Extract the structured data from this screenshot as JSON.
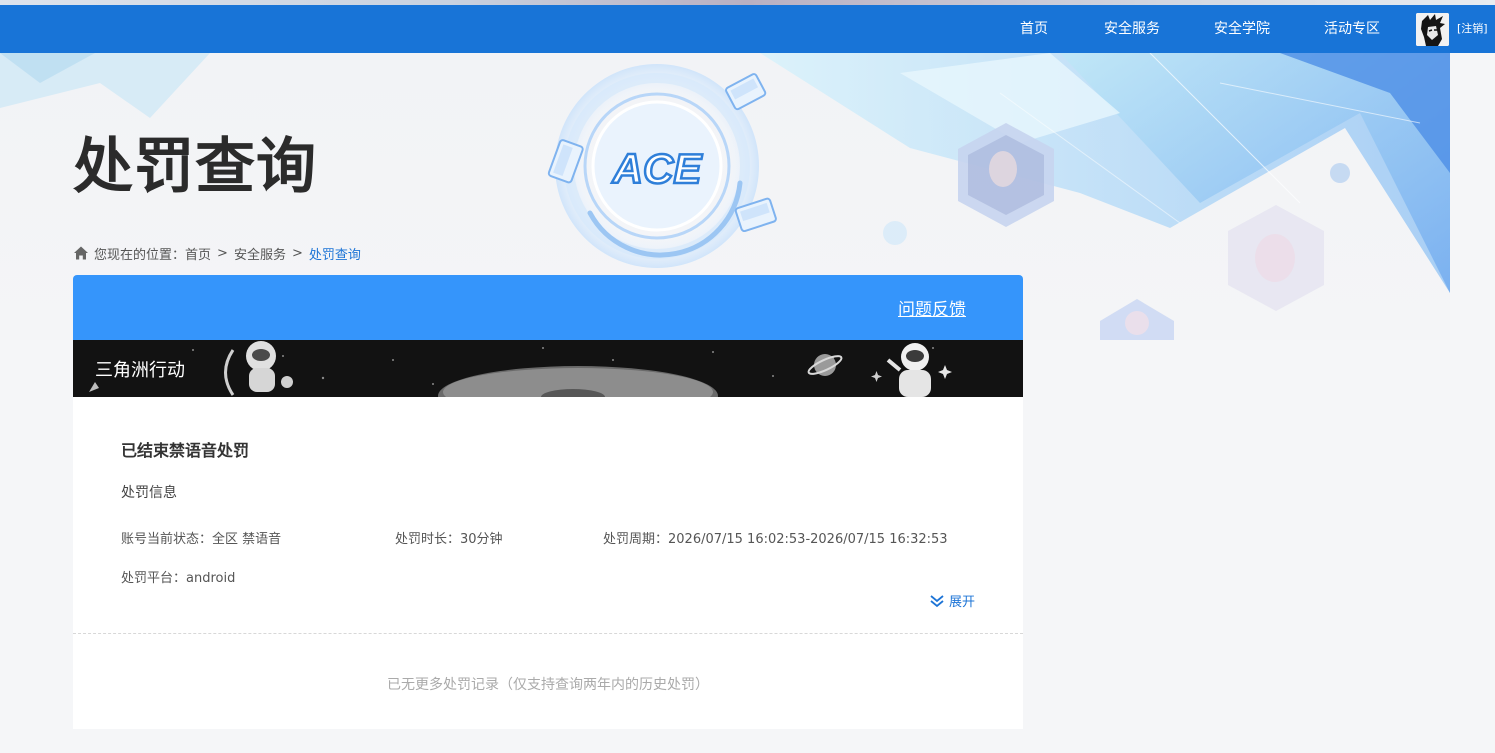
{
  "nav": {
    "items": [
      "首页",
      "安全服务",
      "安全学院",
      "活动专区"
    ],
    "logout": "[注销]"
  },
  "page": {
    "title": "处罚查询"
  },
  "breadcrumb": {
    "prefix": "您现在的位置：",
    "items": [
      "首页",
      "安全服务",
      "处罚查询"
    ],
    "separator": ">"
  },
  "card": {
    "feedback": "问题反馈",
    "game_name": "三角洲行动",
    "record_title": "已结束禁语音处罚",
    "section_label": "处罚信息",
    "status": "账号当前状态：全区 禁语音",
    "duration": "处罚时长：30分钟",
    "period": "处罚周期：2026/07/15 16:02:53-2026/07/15 16:32:53",
    "platform": "处罚平台：android",
    "expand": "展开",
    "no_more": "已无更多处罚记录（仅支持查询两年内的历史处罚）"
  },
  "logo_text": "ACE",
  "icons": {
    "home": "home-icon",
    "expand": "double-chevron-down-icon"
  },
  "colors": {
    "nav_bg": "#1874d7",
    "card_header": "#3595fb",
    "link": "#1d74d6"
  }
}
